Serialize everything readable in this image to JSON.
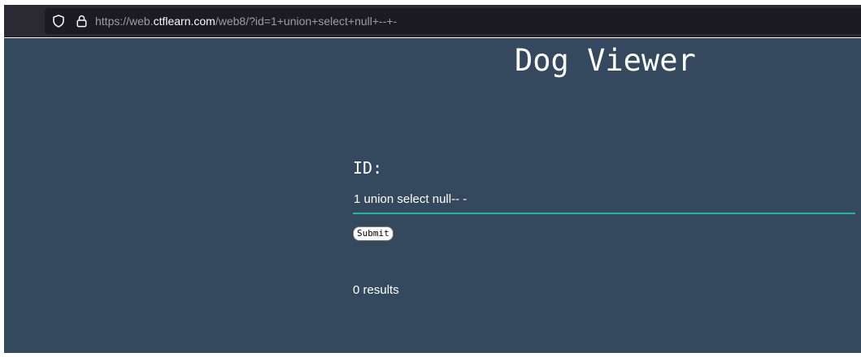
{
  "browser": {
    "url_prefix": "https://web.",
    "url_domain": "ctflearn.com",
    "url_rest": "/web8/?id=1+union+select+null+--+-",
    "icons": [
      "shield-icon",
      "lock-icon"
    ]
  },
  "page": {
    "title": "Dog Viewer",
    "id_label": "ID:",
    "id_input_value": "1 union select null-- -",
    "submit_label": "Submit",
    "results_text": "0 results"
  },
  "colors": {
    "page_bg": "#34495e",
    "input_underline": "#1abc9c",
    "toolbar_bg": "#2b2a33",
    "urlbar_bg": "#1c1b22"
  }
}
